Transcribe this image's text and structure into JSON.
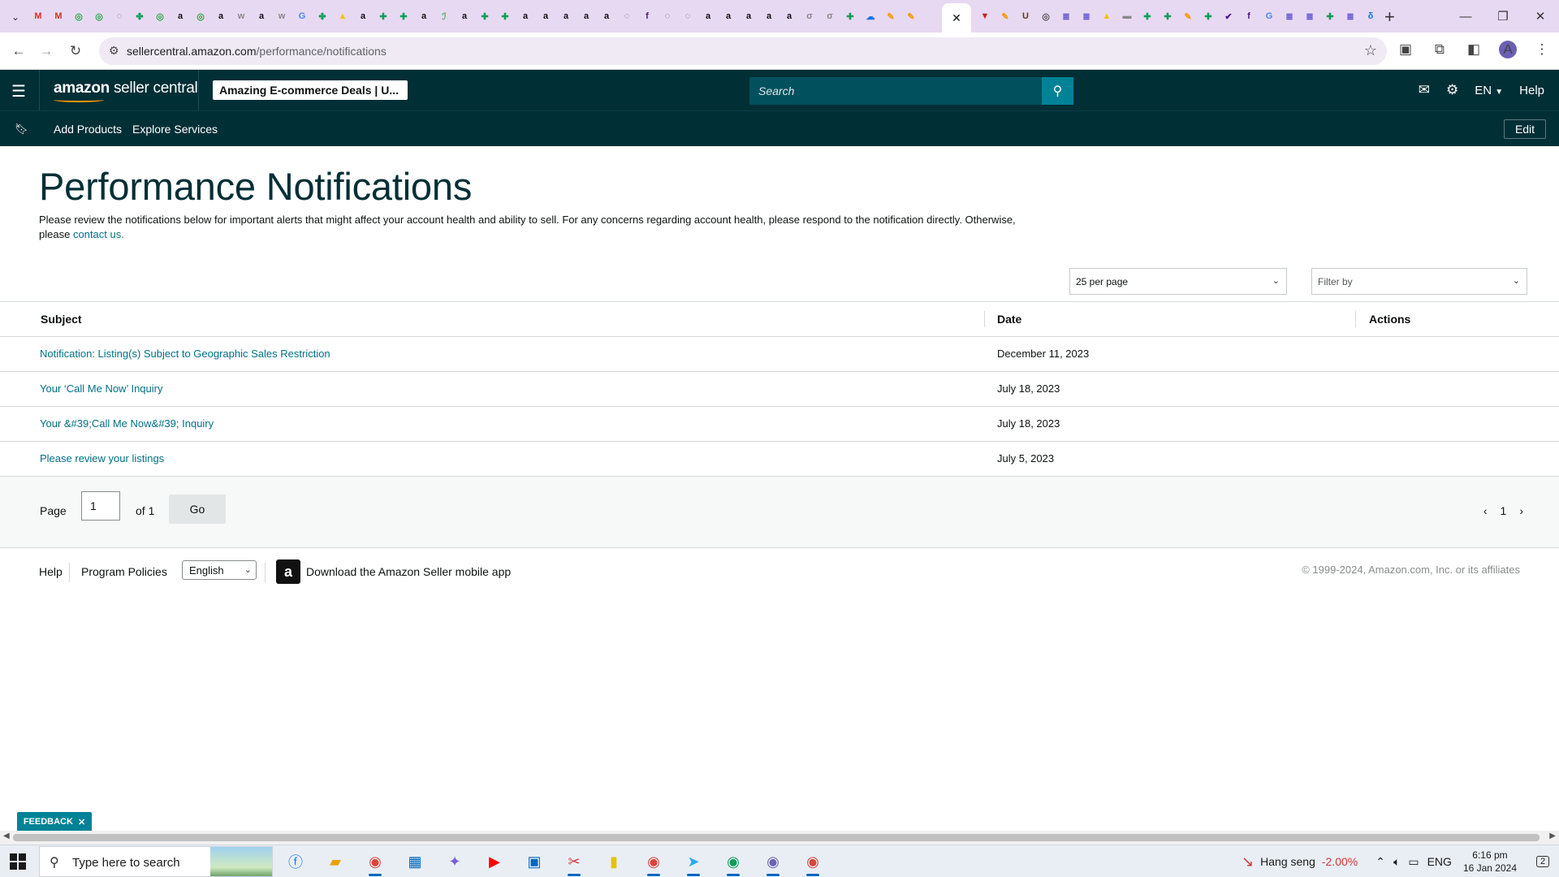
{
  "browser": {
    "url_domain": "sellercentral.amazon.com",
    "url_path": "/performance/notifications",
    "active_tab_close": "✕",
    "new_tab": "+",
    "window_controls": [
      "—",
      "❐",
      "✕"
    ],
    "profile_initial": "A",
    "tab_favicons": [
      {
        "glyph": "M",
        "color": "#d93025"
      },
      {
        "glyph": "M",
        "color": "#d93025"
      },
      {
        "glyph": "◎",
        "color": "#2aa745"
      },
      {
        "glyph": "◎",
        "color": "#2aa745"
      },
      {
        "glyph": "◌",
        "color": "#5f6368"
      },
      {
        "glyph": "✤",
        "color": "#0f9d58"
      },
      {
        "glyph": "◎",
        "color": "#2aa745"
      },
      {
        "glyph": "a",
        "color": "#111111"
      },
      {
        "glyph": "◎",
        "color": "#2aa745"
      },
      {
        "glyph": "a",
        "color": "#111111"
      },
      {
        "glyph": "w",
        "color": "#888888"
      },
      {
        "glyph": "a",
        "color": "#111111"
      },
      {
        "glyph": "w",
        "color": "#888888"
      },
      {
        "glyph": "G",
        "color": "#4285f4"
      },
      {
        "glyph": "✤",
        "color": "#0f9d58"
      },
      {
        "glyph": "▲",
        "color": "#fbbc04"
      },
      {
        "glyph": "a",
        "color": "#111111"
      },
      {
        "glyph": "✚",
        "color": "#0f9d58"
      },
      {
        "glyph": "✚",
        "color": "#0f9d58"
      },
      {
        "glyph": "a",
        "color": "#111111"
      },
      {
        "glyph": "ℐ",
        "color": "#4caf50"
      },
      {
        "glyph": "a",
        "color": "#111111"
      },
      {
        "glyph": "✚",
        "color": "#0f9d58"
      },
      {
        "glyph": "✚",
        "color": "#0f9d58"
      },
      {
        "glyph": "a",
        "color": "#111111"
      },
      {
        "glyph": "a",
        "color": "#111111"
      },
      {
        "glyph": "a",
        "color": "#111111"
      },
      {
        "glyph": "a",
        "color": "#111111"
      },
      {
        "glyph": "a",
        "color": "#111111"
      },
      {
        "glyph": "◌",
        "color": "#5f6368"
      },
      {
        "glyph": "f",
        "color": "#4d148c"
      },
      {
        "glyph": "◌",
        "color": "#5f6368"
      },
      {
        "glyph": "◌",
        "color": "#5f6368"
      },
      {
        "glyph": "a",
        "color": "#111111"
      },
      {
        "glyph": "a",
        "color": "#111111"
      },
      {
        "glyph": "a",
        "color": "#111111"
      },
      {
        "glyph": "a",
        "color": "#111111"
      },
      {
        "glyph": "a",
        "color": "#111111"
      },
      {
        "glyph": "σ",
        "color": "#888888"
      },
      {
        "glyph": "σ",
        "color": "#888888"
      },
      {
        "glyph": "✚",
        "color": "#0f9d58"
      },
      {
        "glyph": "☁",
        "color": "#1a73e8"
      },
      {
        "glyph": "✎",
        "color": "#f29900"
      },
      {
        "glyph": "✎",
        "color": "#f29900"
      }
    ],
    "tab_favicons_right": [
      {
        "glyph": "▼",
        "color": "#c5221f"
      },
      {
        "glyph": "✎",
        "color": "#f29900"
      },
      {
        "glyph": "U",
        "color": "#5c3d15"
      },
      {
        "glyph": "◎",
        "color": "#555555"
      },
      {
        "glyph": "≣",
        "color": "#5a4fcf"
      },
      {
        "glyph": "≣",
        "color": "#5a4fcf"
      },
      {
        "glyph": "▲",
        "color": "#fbbc04"
      },
      {
        "glyph": "▬",
        "color": "#888888"
      },
      {
        "glyph": "✚",
        "color": "#0f9d58"
      },
      {
        "glyph": "✚",
        "color": "#0f9d58"
      },
      {
        "glyph": "✎",
        "color": "#f29900"
      },
      {
        "glyph": "✚",
        "color": "#0f9d58"
      },
      {
        "glyph": "✔",
        "color": "#4d148c"
      },
      {
        "glyph": "f",
        "color": "#4d148c"
      },
      {
        "glyph": "G",
        "color": "#4285f4"
      },
      {
        "glyph": "≣",
        "color": "#5a4fcf"
      },
      {
        "glyph": "≣",
        "color": "#5a4fcf"
      },
      {
        "glyph": "✚",
        "color": "#0f9d58"
      },
      {
        "glyph": "≣",
        "color": "#5a4fcf"
      },
      {
        "glyph": "δ",
        "color": "#1a73e8"
      }
    ]
  },
  "header": {
    "logo_brand": "amazon",
    "logo_product": "seller central",
    "store_name": "Amazing E-commerce Deals | U...",
    "search_placeholder": "Search",
    "language": "EN",
    "help": "Help"
  },
  "subnav": {
    "links": [
      "Add Products",
      "Explore Services"
    ],
    "edit": "Edit"
  },
  "main": {
    "title": "Performance Notifications",
    "description": "Please review the notifications below for important alerts that might affect your account health and ability to sell. For any concerns regarding account health, please respond to the notification directly. Otherwise, please",
    "contact_link": "contact us.",
    "per_page": "25 per page",
    "filter_placeholder": "Filter by"
  },
  "table": {
    "headers": {
      "subject": "Subject",
      "date": "Date",
      "actions": "Actions"
    },
    "rows": [
      {
        "subject": "Notification: Listing(s) Subject to Geographic Sales Restriction",
        "date": "December 11, 2023"
      },
      {
        "subject": "Your ‘Call Me Now’ Inquiry",
        "date": "July 18, 2023"
      },
      {
        "subject": "Your &#39;Call Me Now&#39; Inquiry",
        "date": "July 18, 2023"
      },
      {
        "subject": "Please review your listings",
        "date": "July 5, 2023"
      }
    ]
  },
  "pagination": {
    "page_label": "Page",
    "current_page": "1",
    "of_label": "of 1",
    "go": "Go",
    "nav_page": "1"
  },
  "footer": {
    "help": "Help",
    "program_policies": "Program Policies",
    "language": "English",
    "app_link": "Download the Amazon Seller mobile app",
    "copyright": "© 1999-2024, Amazon.com, Inc. or its affiliates"
  },
  "feedback": {
    "label": "FEEDBACK",
    "close": "✕"
  },
  "taskbar": {
    "search_placeholder": "Type here to search",
    "ticker_name": "Hang seng",
    "ticker_change": "-2.00%",
    "language": "ENG",
    "time": "6:16 pm",
    "date": "16 Jan 2024",
    "notification_count": "2"
  },
  "colors": {
    "header_bg": "#002f36",
    "link": "#007185",
    "search_button": "#008296",
    "tabstrip": "#e8d9f2"
  }
}
